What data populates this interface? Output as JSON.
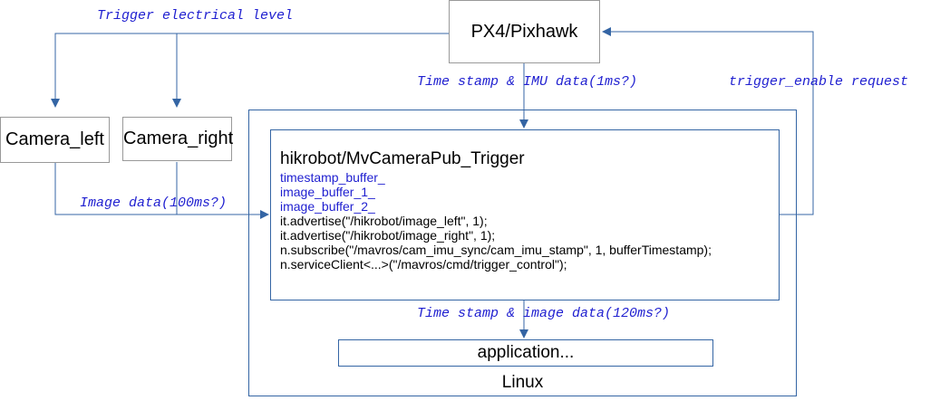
{
  "px4_label": "PX4/Pixhawk",
  "camera_left_label": "Camera_left",
  "camera_right_label": "Camera_right",
  "linux_label": "Linux",
  "application_label": "application...",
  "flow_labels": {
    "trigger": "Trigger electrical level",
    "imu": "Time stamp & IMU data(1ms?)",
    "trigger_enable": "trigger_enable request",
    "image": "Image data(100ms?)",
    "image_out": "Time stamp & image data(120ms?)"
  },
  "node": {
    "title": "hikrobot/MvCameraPub_Trigger",
    "buffers": [
      "timestamp_buffer_",
      "image_buffer_1_",
      "image_buffer_2_"
    ],
    "calls": [
      "it.advertise(\"/hikrobot/image_left\", 1);",
      "it.advertise(\"/hikrobot/image_right\", 1);",
      "n.subscribe(\"/mavros/cam_imu_sync/cam_imu_stamp\", 1, bufferTimestamp);",
      "n.serviceClient<...>(\"/mavros/cmd/trigger_control\");"
    ]
  },
  "colors": {
    "connector": "#3465a4",
    "annotation_text": "#1f1fd0",
    "box_border": "#999999"
  }
}
